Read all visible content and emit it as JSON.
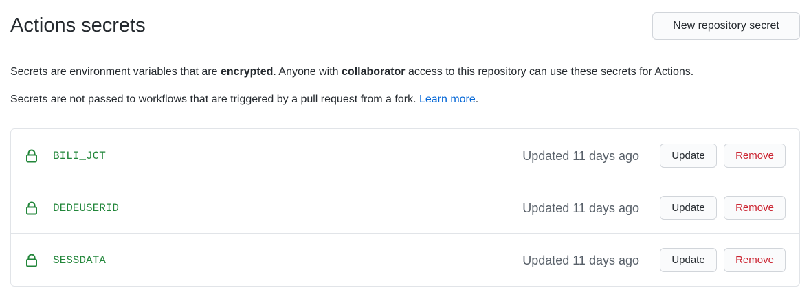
{
  "header": {
    "title": "Actions secrets",
    "new_secret_label": "New repository secret"
  },
  "description": {
    "line1_part1": "Secrets are environment variables that are ",
    "line1_bold1": "encrypted",
    "line1_part2": ". Anyone with ",
    "line1_bold2": "collaborator",
    "line1_part3": " access to this repository can use these secrets for Actions.",
    "line2_text": "Secrets are not passed to workflows that are triggered by a pull request from a fork. ",
    "line2_link": "Learn more",
    "line2_end": "."
  },
  "secrets": [
    {
      "name": "BILI_JCT",
      "updated": "Updated 11 days ago",
      "update_label": "Update",
      "remove_label": "Remove",
      "icon": "lock-icon"
    },
    {
      "name": "DEDEUSERID",
      "updated": "Updated 11 days ago",
      "update_label": "Update",
      "remove_label": "Remove",
      "icon": "lock-icon"
    },
    {
      "name": "SESSDATA",
      "updated": "Updated 11 days ago",
      "update_label": "Update",
      "remove_label": "Remove",
      "icon": "lock-icon"
    }
  ],
  "colors": {
    "secret_name": "#22863a",
    "link": "#0366d6",
    "danger": "#cb2431",
    "muted": "#586069"
  }
}
